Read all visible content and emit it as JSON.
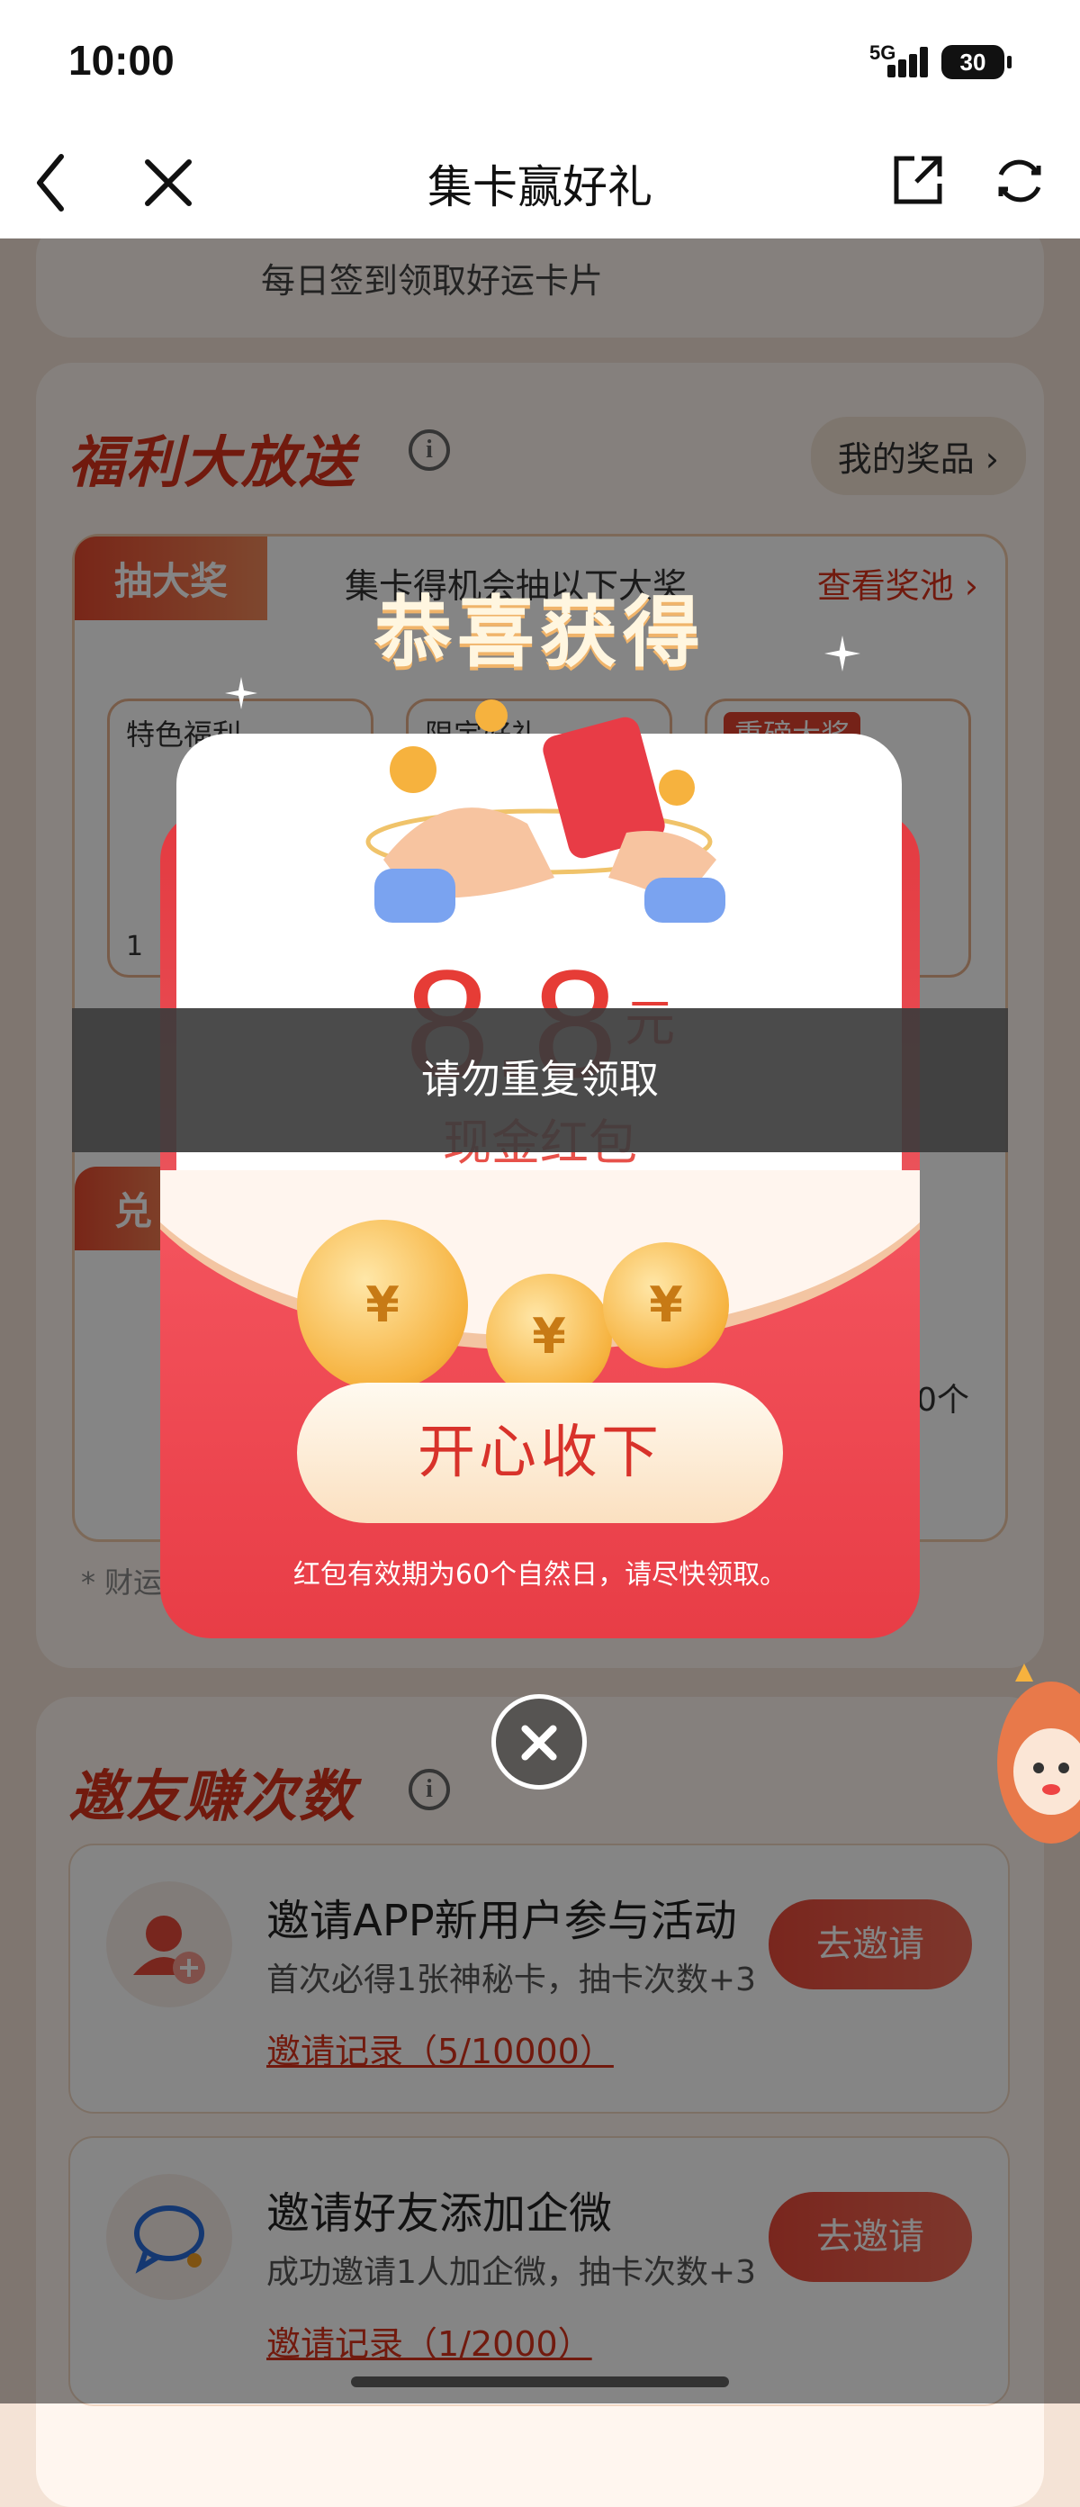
{
  "status_bar": {
    "time": "10:00",
    "network": "5G",
    "battery": "30"
  },
  "nav": {
    "title": "集卡赢好礼"
  },
  "background": {
    "checkin_text": "每日签到领取好运卡片",
    "welfare": {
      "title": "福利大放送",
      "my_prizes": "我的奖品 ›",
      "tab_label": "抽大奖",
      "tab_desc": "集卡得机会抽以下大奖",
      "view_pool": "查看奖池 ›",
      "cards": [
        "特色福利",
        "限定好礼",
        "重磅大奖"
      ],
      "partial_count": "1",
      "exchange_tab": "兑",
      "exchange_count": "0个",
      "note": "* 财运"
    },
    "invite": {
      "title": "邀友赚次数",
      "rows": [
        {
          "title": "邀请APP新用户参与活动",
          "desc": "首次必得1张神秘卡，抽卡次数+3",
          "record": "邀请记录（5/10000）",
          "button": "去邀请"
        },
        {
          "title": "邀请好友添加企微",
          "desc": "成功邀请1人加企微，抽卡次数+3",
          "record": "邀请记录（1/2000）",
          "button": "去邀请"
        }
      ]
    }
  },
  "modal": {
    "heading": "恭喜获得",
    "amount": "8.8",
    "unit": "元",
    "prize_label": "现金红包",
    "accept_button": "开心收下",
    "validity_note": "红包有效期为60个自然日，请尽快领取。",
    "coin_symbol": "¥"
  },
  "toast": {
    "message": "请勿重复领取"
  },
  "colors": {
    "primary_red": "#e63c36",
    "overlay": "rgba(0,0,0,0.48)"
  }
}
